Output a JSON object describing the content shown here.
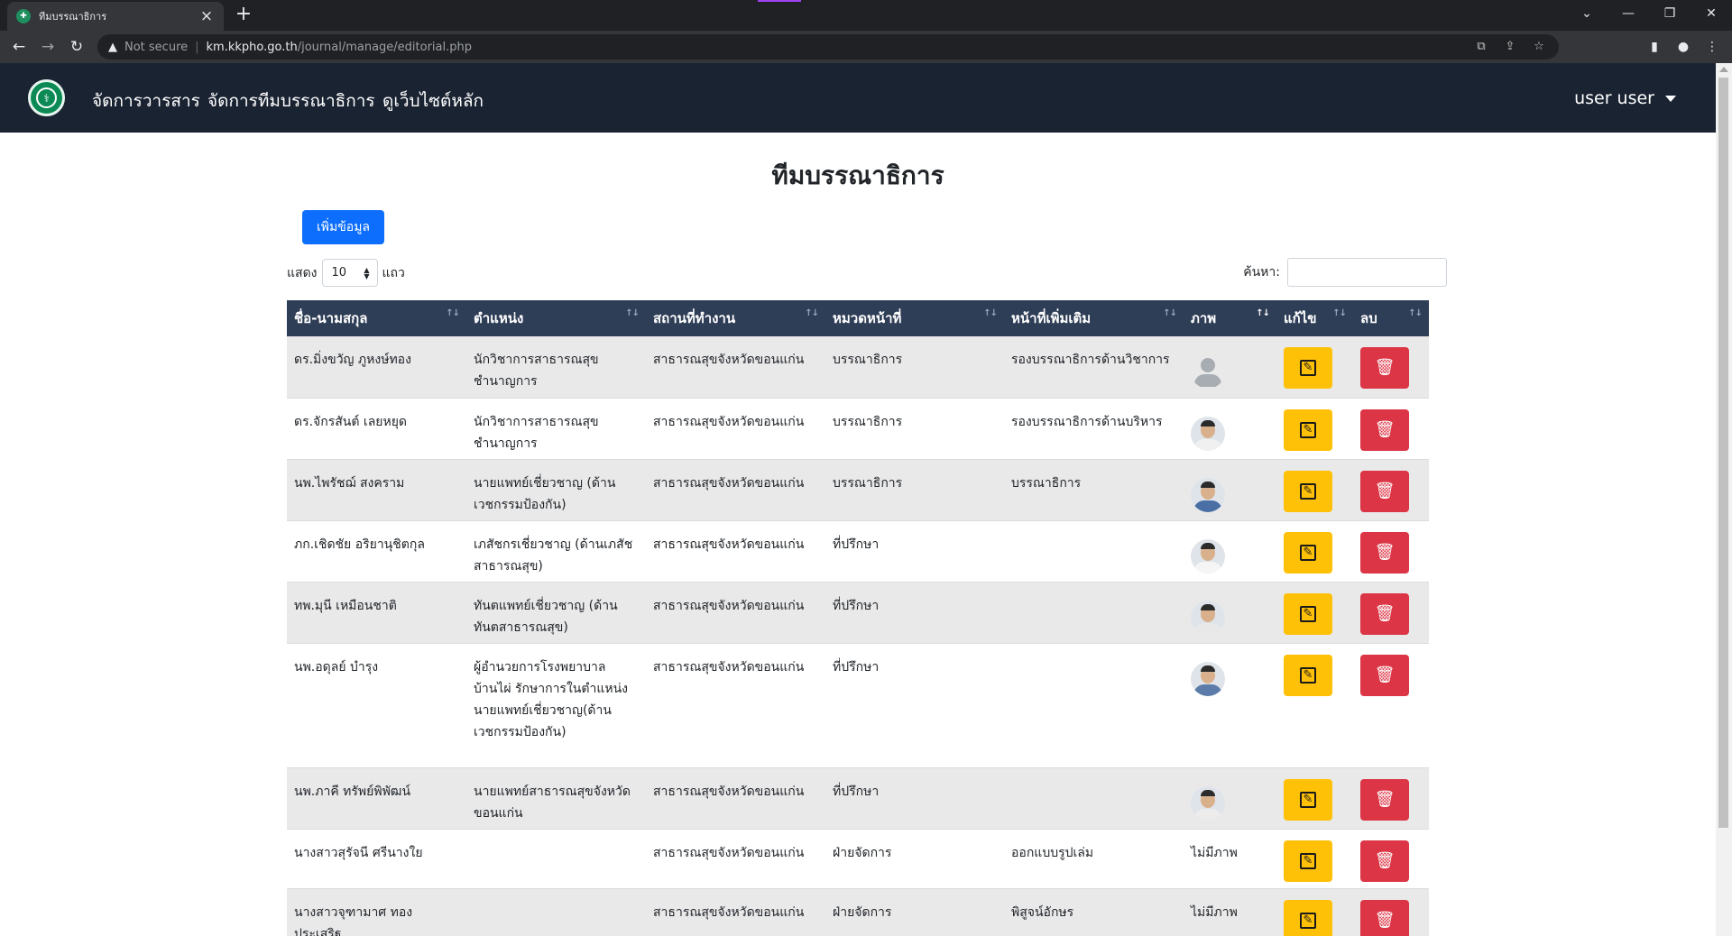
{
  "browser": {
    "tab_title": "ทีมบรรณาธิการ",
    "not_secure": "Not secure",
    "url_host": "km.kkpho.go.th",
    "url_path": "/journal/manage/editorial.php",
    "icons": [
      "back-icon",
      "forward-icon",
      "reload-icon",
      "warning-icon",
      "translate-icon",
      "share-icon",
      "star-icon",
      "sidepanel-icon",
      "profile-icon",
      "menu-icon"
    ]
  },
  "navbar": {
    "links": [
      "จัดการวารสาร",
      "จัดการทีมบรรณาธิการ",
      "ดูเว็บไซต์หลัก"
    ],
    "user": "user user",
    "bg_color": "#1a2332"
  },
  "page": {
    "title": "ทีมบรรณาธิการ",
    "add_button": "เพิ่มข้อมูล",
    "length_prefix": "แสดง",
    "length_value": "10",
    "length_suffix": "แถว",
    "search_label": "ค้นหา:",
    "search_value": ""
  },
  "table": {
    "headers": [
      "ชื่อ-นามสกุล",
      "ตำแหน่ง",
      "สถานที่ทำงาน",
      "หมวดหน้าที่",
      "หน้าที่เพิ่มเติม",
      "ภาพ",
      "แก้ไข",
      "ลบ"
    ],
    "sorted_column": "ภาพ",
    "rows": [
      {
        "name": "ดร.มิ่งขวัญ ภูหงษ์ทอง",
        "position": "นักวิชาการสาธารณสุขชำนาญการ",
        "workplace": "สาธารณสุขจังหวัดขอนแก่น",
        "category": "บรรณาธิการ",
        "extra": "รองบรรณาธิการด้านวิชาการ",
        "image": "placeholder",
        "image_text": ""
      },
      {
        "name": "ดร.จักรสันต์ เลยหยุด",
        "position": "นักวิชาการสาธารณสุขชำนาญการ",
        "workplace": "สาธารณสุขจังหวัดขอนแก่น",
        "category": "บรรณาธิการ",
        "extra": "รองบรรณาธิการด้านบริหาร",
        "image": "photo",
        "image_text": ""
      },
      {
        "name": "นพ.ไพรัชฌ์ สงคราม",
        "position": "นายแพทย์เชี่ยวชาญ (ด้านเวชกรรมป้องกัน)",
        "workplace": "สาธารณสุขจังหวัดขอนแก่น",
        "category": "บรรณาธิการ",
        "extra": "บรรณาธิการ",
        "image": "photo",
        "image_text": ""
      },
      {
        "name": "ภก.เชิดชัย อริยานุชิตกุล",
        "position": "เภสัชกรเชี่ยวชาญ (ด้านเภสัชสาธารณสุข)",
        "workplace": "สาธารณสุขจังหวัดขอนแก่น",
        "category": "ที่ปรึกษา",
        "extra": "",
        "image": "photo",
        "image_text": ""
      },
      {
        "name": "ทพ.มุนี เหมือนชาติ",
        "position": "ทันตแพทย์เชี่ยวชาญ (ด้านทันตสาธารณสุข)",
        "workplace": "สาธารณสุขจังหวัดขอนแก่น",
        "category": "ที่ปรึกษา",
        "extra": "",
        "image": "photo",
        "image_text": ""
      },
      {
        "name": "นพ.อดุลย์ บำรุง",
        "position": "ผู้อำนวยการโรงพยาบาลบ้านไผ่ รักษาการในตำแหน่งนายแพทย์เชี่ยวชาญ(ด้านเวชกรรมป้องกัน)",
        "workplace": "สาธารณสุขจังหวัดขอนแก่น",
        "category": "ที่ปรึกษา",
        "extra": "",
        "image": "photo",
        "image_text": ""
      },
      {
        "name": "นพ.ภาคี ทรัพย์พิพัฒน์",
        "position": "นายแพทย์สาธารณสุขจังหวัดขอนแก่น",
        "workplace": "สาธารณสุขจังหวัดขอนแก่น",
        "category": "ที่ปรึกษา",
        "extra": "",
        "image": "photo",
        "image_text": ""
      },
      {
        "name": "นางสาวสุรัจนี ศรีนางใย",
        "position": "",
        "workplace": "สาธารณสุขจังหวัดขอนแก่น",
        "category": "ฝ่ายจัดการ",
        "extra": "ออกแบบรูปเล่ม",
        "image": "none",
        "image_text": "ไม่มีภาพ"
      },
      {
        "name": "นางสาวจุฑามาศ ทองประเสริฐ",
        "position": "",
        "workplace": "สาธารณสุขจังหวัดขอนแก่น",
        "category": "ฝ่ายจัดการ",
        "extra": "พิสูจน์อักษร",
        "image": "none",
        "image_text": "ไม่มีภาพ"
      }
    ]
  },
  "colors": {
    "header_bg": "#2f3e57",
    "add_button": "#0d6efd",
    "edit_button": "#ffc107",
    "delete_button": "#dc3545"
  }
}
